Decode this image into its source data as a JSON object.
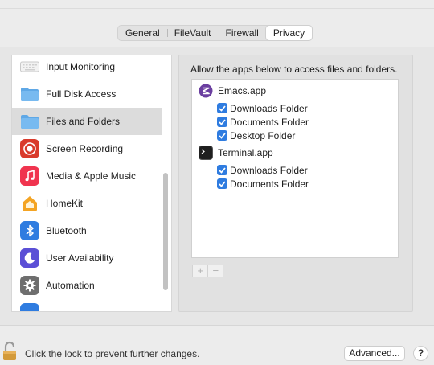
{
  "tabs": [
    {
      "label": "General"
    },
    {
      "label": "FileVault"
    },
    {
      "label": "Firewall"
    },
    {
      "label": "Privacy",
      "active": true
    }
  ],
  "sidebar": {
    "items": [
      {
        "label": "Input Monitoring",
        "icon": "keyboard-icon"
      },
      {
        "label": "Full Disk Access",
        "icon": "folder-icon"
      },
      {
        "label": "Files and Folders",
        "icon": "folder-icon",
        "selected": true
      },
      {
        "label": "Screen Recording",
        "icon": "screen-recording-icon"
      },
      {
        "label": "Media & Apple Music",
        "icon": "music-icon"
      },
      {
        "label": "HomeKit",
        "icon": "home-icon"
      },
      {
        "label": "Bluetooth",
        "icon": "bluetooth-icon"
      },
      {
        "label": "User Availability",
        "icon": "moon-icon"
      },
      {
        "label": "Automation",
        "icon": "gear-icon"
      }
    ]
  },
  "main": {
    "intro": "Allow the apps below to access files and folders.",
    "apps": [
      {
        "name": "Emacs.app",
        "icon": "emacs-icon",
        "folders": [
          "Downloads Folder",
          "Documents Folder",
          "Desktop Folder"
        ]
      },
      {
        "name": "Terminal.app",
        "icon": "terminal-icon",
        "folders": [
          "Downloads Folder",
          "Documents Folder"
        ]
      }
    ],
    "add_symbol": "+",
    "remove_symbol": "−"
  },
  "footer": {
    "lock_text": "Click the lock to prevent further changes.",
    "advanced_label": "Advanced...",
    "help_label": "?"
  },
  "colors": {
    "accent": "#2f7ce0",
    "window_bg": "#ececec"
  }
}
